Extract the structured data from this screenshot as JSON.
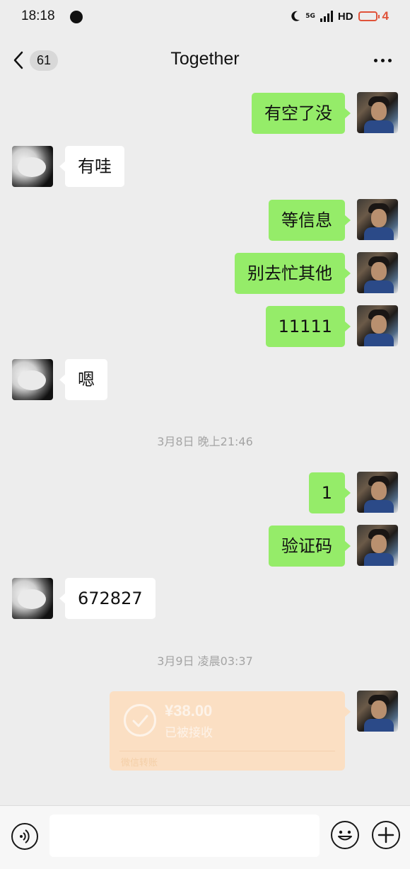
{
  "status_bar": {
    "time": "18:18",
    "network": "5G",
    "hd": "HD",
    "battery": "4",
    "accent_color": "#e0533a"
  },
  "nav": {
    "unread_count": "61",
    "title": "Together"
  },
  "messages": [
    {
      "from": "me",
      "text": "有空了没"
    },
    {
      "from": "other",
      "text": "有哇"
    },
    {
      "from": "me",
      "text": "等信息"
    },
    {
      "from": "me",
      "text": "别去忙其他"
    },
    {
      "from": "me",
      "text": "11111"
    },
    {
      "from": "other",
      "text": "嗯"
    },
    {
      "type": "timestamp",
      "text": "3月8日 晚上21:46"
    },
    {
      "from": "me",
      "text": "1"
    },
    {
      "from": "me",
      "text": "验证码"
    },
    {
      "from": "other",
      "text": "672827"
    },
    {
      "type": "timestamp",
      "text": "3月9日 凌晨03:37"
    },
    {
      "from": "me",
      "type": "transfer",
      "amount": "¥38.00",
      "status": "已被接收",
      "footer": "微信转账"
    }
  ],
  "colors": {
    "background": "#ededed",
    "my_bubble": "#95ec69",
    "their_bubble": "#ffffff",
    "transfer_card": "#fbdfc3"
  },
  "icons": {
    "voice": "voice-icon",
    "emoji": "emoji-icon",
    "plus": "plus-icon",
    "back": "chevron-left-icon",
    "more": "more-dots-icon"
  }
}
